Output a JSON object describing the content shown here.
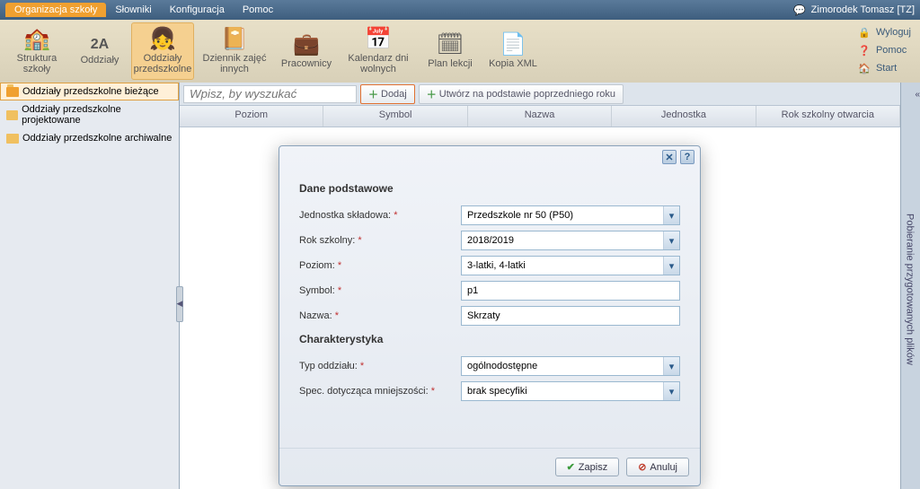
{
  "menu": {
    "tabs": [
      "Organizacja szkoły",
      "Słowniki",
      "Konfiguracja",
      "Pomoc"
    ],
    "active_index": 0,
    "user": "Zimorodek Tomasz [TZ]"
  },
  "ribbon": {
    "items": [
      {
        "label": "Struktura szkoły",
        "icon": "🏫"
      },
      {
        "label": "Oddziały",
        "icon": "2A"
      },
      {
        "label": "Oddziały przedszkolne",
        "icon": "👧",
        "active": true
      },
      {
        "label": "Dziennik zajęć innych",
        "icon": "📔"
      },
      {
        "label": "Pracownicy",
        "icon": "💼"
      },
      {
        "label": "Kalendarz dni wolnych",
        "icon": "📅"
      },
      {
        "label": "Plan lekcji",
        "icon": "🗓"
      },
      {
        "label": "Kopia XML",
        "icon": "📄"
      }
    ],
    "right_links": [
      {
        "label": "Wyloguj",
        "icon": "🔒"
      },
      {
        "label": "Pomoc",
        "icon": "❓"
      },
      {
        "label": "Start",
        "icon": "🏠"
      }
    ]
  },
  "sidebar": {
    "items": [
      {
        "label": "Oddziały przedszkolne bieżące",
        "selected": true
      },
      {
        "label": "Oddziały przedszkolne projektowane",
        "selected": false
      },
      {
        "label": "Oddziały przedszkolne archiwalne",
        "selected": false
      }
    ]
  },
  "toolbar": {
    "search_placeholder": "Wpisz, by wyszukać",
    "add_label": "Dodaj",
    "add_prev_label": "Utwórz na podstawie poprzedniego roku"
  },
  "grid": {
    "columns": [
      "Poziom",
      "Symbol",
      "Nazwa",
      "Jednostka",
      "Rok szkolny otwarcia"
    ]
  },
  "rail": {
    "label": "Pobieranie przygotowanych plików"
  },
  "dialog": {
    "section1": "Dane podstawowe",
    "section2": "Charakterystyka",
    "fields": {
      "jednostka_label": "Jednostka składowa:",
      "jednostka_value": "Przedszkole nr 50 (P50)",
      "rok_label": "Rok szkolny:",
      "rok_value": "2018/2019",
      "poziom_label": "Poziom:",
      "poziom_value": "3-latki, 4-latki",
      "symbol_label": "Symbol:",
      "symbol_value": "p1",
      "nazwa_label": "Nazwa:",
      "nazwa_value": "Skrzaty",
      "typ_label": "Typ oddziału:",
      "typ_value": "ogólnodostępne",
      "spec_label": "Spec. dotycząca mniejszości:",
      "spec_value": "brak specyfiki"
    },
    "save": "Zapisz",
    "cancel": "Anuluj"
  }
}
